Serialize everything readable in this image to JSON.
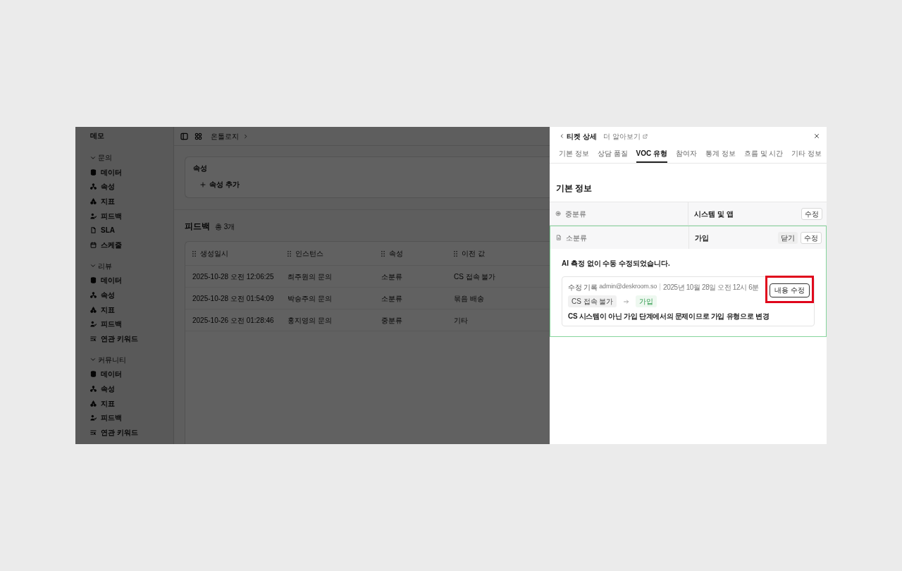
{
  "sidebar": {
    "title": "데모",
    "sections": [
      {
        "label": "문의",
        "expanded": true,
        "items": [
          {
            "label": "데이터",
            "kind": "data"
          },
          {
            "label": "속성",
            "kind": "attribute"
          },
          {
            "label": "지표",
            "kind": "metric"
          },
          {
            "label": "피드백",
            "kind": "feedback"
          },
          {
            "label": "SLA",
            "kind": "sla"
          },
          {
            "label": "스케줄",
            "kind": "schedule"
          }
        ]
      },
      {
        "label": "리뷰",
        "expanded": true,
        "items": [
          {
            "label": "데이터",
            "kind": "data"
          },
          {
            "label": "속성",
            "kind": "attribute"
          },
          {
            "label": "지표",
            "kind": "metric"
          },
          {
            "label": "피드백",
            "kind": "feedback"
          },
          {
            "label": "연관 키워드",
            "kind": "keywords"
          }
        ]
      },
      {
        "label": "커뮤니티",
        "expanded": true,
        "items": [
          {
            "label": "데이터",
            "kind": "data"
          },
          {
            "label": "속성",
            "kind": "attribute"
          },
          {
            "label": "지표",
            "kind": "metric"
          },
          {
            "label": "피드백",
            "kind": "feedback"
          },
          {
            "label": "연관 키워드",
            "kind": "keywords"
          }
        ]
      }
    ]
  },
  "main": {
    "breadcrumb": [
      "온톨로지"
    ],
    "attribute_card": {
      "title": "속성",
      "add_button": "속성 추가"
    },
    "feedback": {
      "title": "피드백",
      "count": "총 3개",
      "table": {
        "columns": [
          "생성일시",
          "인스턴스",
          "속성",
          "이전 값"
        ],
        "rows": [
          [
            "2025-10-28 오전 12:06:25",
            "최주원의 문의",
            "소분류",
            "CS 접속 불가"
          ],
          [
            "2025-10-28 오전 01:54:09",
            "박승주의 문의",
            "소분류",
            "묶음 배송"
          ],
          [
            "2025-10-26 오전 01:28:46",
            "홍지영의 문의",
            "중분류",
            "기타"
          ]
        ]
      }
    }
  },
  "panel": {
    "title": "티켓 상세",
    "link": "더 알아보기",
    "tabs": [
      {
        "label": "기본 정보",
        "selected": false
      },
      {
        "label": "상담 품질",
        "selected": false
      },
      {
        "label": "VOC 유형",
        "selected": true
      },
      {
        "label": "참여자",
        "selected": false
      },
      {
        "label": "통계 정보",
        "selected": false
      },
      {
        "label": "흐름 및 시간",
        "selected": false
      },
      {
        "label": "기타 정보",
        "selected": false
      }
    ],
    "section_title": "기본 정보",
    "fields": [
      {
        "kind": "category",
        "label": "중분류",
        "value": "시스템 및 앱",
        "expanded": false,
        "actions": [
          {
            "label": "수정",
            "kind": "outline"
          }
        ]
      },
      {
        "kind": "subcategory",
        "label": "소분류",
        "value": "가입",
        "expanded": true,
        "actions": [
          {
            "label": "닫기",
            "kind": "ghost"
          },
          {
            "label": "수정",
            "kind": "outline"
          }
        ],
        "detail": {
          "notice": "AI 측정 없이 수동 수정되었습니다.",
          "history": {
            "label": "수정 기록",
            "author": "admin@deskroom.so",
            "date": "2025년 10월 28일 오전 12시 6분",
            "previous": "CS 접속 불가",
            "current": "가입",
            "reason": "CS 시스템이 아닌 가입 단계에서의 문제이므로 가입 유형으로 변경",
            "edit_button": {
              "label": "내용 수정",
              "highlighted": true
            }
          }
        }
      }
    ]
  }
}
